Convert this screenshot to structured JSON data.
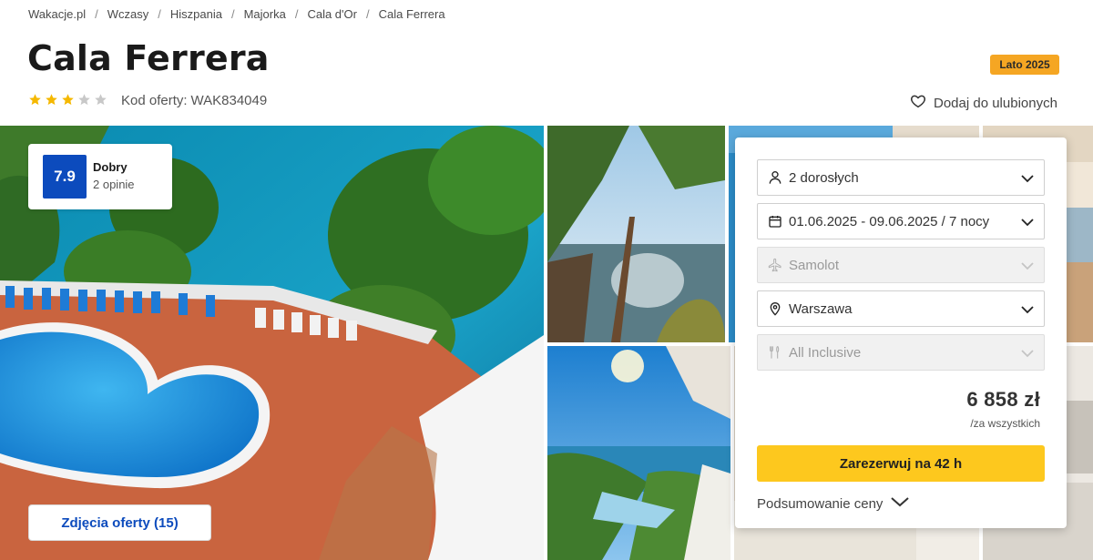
{
  "breadcrumb": {
    "items": [
      "Wakacje.pl",
      "Wczasy",
      "Hiszpania",
      "Majorka",
      "Cala d'Or",
      "Cala Ferrera"
    ],
    "separator": "/"
  },
  "hotel": {
    "title": "Cala Ferrera",
    "stars_filled": 3,
    "stars_total": 5,
    "offer_code_label": "Kod oferty:",
    "offer_code_value": "WAK834049",
    "season_badge": "Lato 2025",
    "favorite_label": "Dodaj do ulubionych"
  },
  "rating": {
    "score": "7.9",
    "label": "Dobry",
    "count": "2 opinie"
  },
  "gallery": {
    "photos_button": "Zdjęcia oferty (15)"
  },
  "booking": {
    "travelers": "2 dorosłych",
    "dates": "01.06.2025 - 09.06.2025 / 7 nocy",
    "transport": "Samolot",
    "departure": "Warszawa",
    "board": "All Inclusive",
    "price": "6 858 zł",
    "price_note": "/za wszystkich",
    "book_button": "Zarezerwuj na 42 h",
    "summary_label": "Podsumowanie ceny"
  },
  "colors": {
    "brand_blue": "#0c4bbd",
    "cta_yellow": "#fdc81e",
    "badge_orange": "#f5a623",
    "star_gold": "#f5b800",
    "star_grey": "#c8c8c8"
  },
  "icons": [
    "user-icon",
    "calendar-icon",
    "plane-icon",
    "location-pin-icon",
    "cutlery-icon",
    "chevron-down-icon",
    "heart-icon",
    "star-icon"
  ]
}
